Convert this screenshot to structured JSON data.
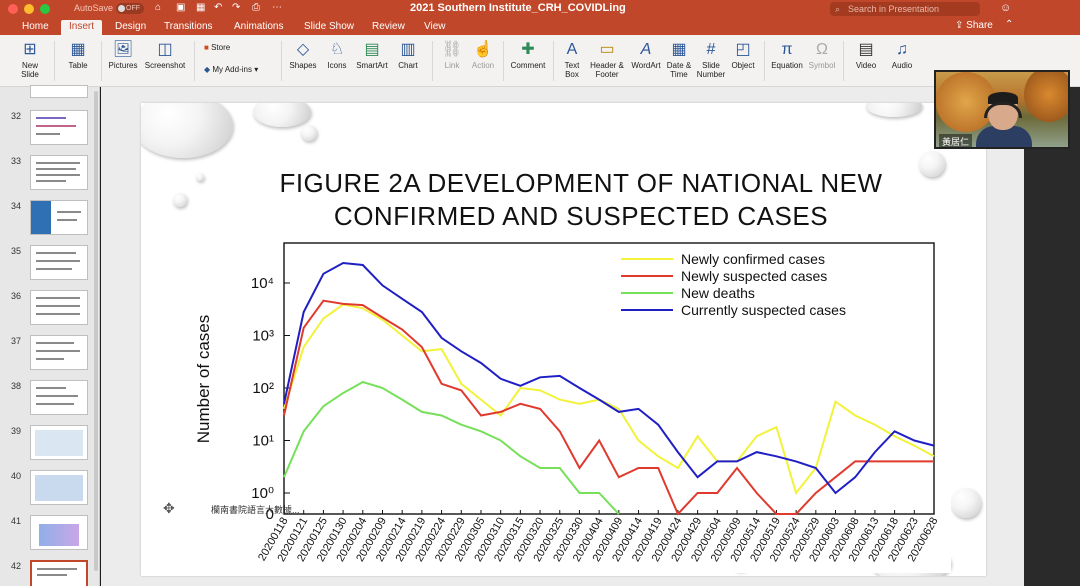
{
  "window": {
    "autosave_label": "AutoSave",
    "autosave_state": "OFF",
    "title": "2021 Southern Institute_CRH_COVIDLing",
    "search_placeholder": "Search in Presentation",
    "share_label": "Share"
  },
  "tabs": [
    "Home",
    "Insert",
    "Design",
    "Transitions",
    "Animations",
    "Slide Show",
    "Review",
    "View"
  ],
  "active_tab": "Insert",
  "ribbon": {
    "new_slide": "New Slide",
    "table": "Table",
    "pictures": "Pictures",
    "screenshot": "Screenshot",
    "store": "Store",
    "my_addins": "My Add-ins",
    "shapes": "Shapes",
    "icons": "Icons",
    "smartart": "SmartArt",
    "chart": "Chart",
    "link": "Link",
    "action": "Action",
    "comment": "Comment",
    "text_box": "Text Box",
    "header_footer": "Header & Footer",
    "wordart": "WordArt",
    "date_time": "Date & Time",
    "slide_number": "Slide Number",
    "object": "Object",
    "equation": "Equation",
    "symbol": "Symbol",
    "video": "Video",
    "audio": "Audio"
  },
  "slide_numbers": [
    "32",
    "33",
    "34",
    "35",
    "36",
    "37",
    "38",
    "39",
    "40",
    "41",
    "42"
  ],
  "selected_slide": "42",
  "slide": {
    "title_line1": "FIGURE 2A DEVELOPMENT OF NATIONAL NEW",
    "title_line2": "CONFIRMED AND SUSPECTED CASES",
    "credit": "欄南書院語言大數據..."
  },
  "participant": {
    "name": "黃居仁"
  },
  "colors": {
    "accent": "#c0472a",
    "confirmed": "#f2f23a",
    "suspected": "#e03a2e",
    "deaths": "#77e05a",
    "current": "#1f1fc4"
  },
  "chart_data": {
    "type": "line",
    "ylabel": "Number of cases",
    "y_scale": "log",
    "yticks": [
      "0",
      "10⁰",
      "10¹",
      "10²",
      "10³",
      "10⁴"
    ],
    "x": [
      "20200118",
      "20200121",
      "20200125",
      "20200130",
      "20200204",
      "20200209",
      "20200214",
      "20200219",
      "20200224",
      "20200229",
      "20200305",
      "20200310",
      "20200315",
      "20200320",
      "20200325",
      "20200330",
      "20200404",
      "20200409",
      "20200414",
      "20200419",
      "20200424",
      "20200429",
      "20200504",
      "20200509",
      "20200514",
      "20200519",
      "20200524",
      "20200529",
      "20200603",
      "20200608",
      "20200613",
      "20200618",
      "20200623",
      "20200628"
    ],
    "series": [
      {
        "name": "Newly confirmed cases",
        "values": [
          40,
          600,
          2100,
          3900,
          3300,
          2000,
          1000,
          500,
          550,
          120,
          60,
          30,
          100,
          90,
          60,
          50,
          60,
          40,
          10,
          5,
          3,
          12,
          4,
          4,
          12,
          18,
          1,
          3,
          55,
          30,
          20,
          12,
          8,
          5
        ]
      },
      {
        "name": "Newly suspected cases",
        "values": [
          30,
          1400,
          4600,
          4000,
          3800,
          2200,
          1300,
          600,
          120,
          90,
          30,
          35,
          50,
          40,
          15,
          3,
          10,
          2,
          3,
          3,
          0,
          1,
          1,
          3,
          1,
          0,
          0,
          1,
          2,
          4,
          4,
          4,
          4,
          4
        ]
      },
      {
        "name": "New deaths",
        "values": [
          2,
          15,
          45,
          80,
          130,
          100,
          60,
          35,
          30,
          20,
          15,
          10,
          5,
          3,
          3,
          1,
          1,
          0,
          0,
          0,
          0,
          0,
          0,
          0,
          0,
          0,
          0,
          0,
          0,
          0,
          0,
          0,
          0,
          0
        ]
      },
      {
        "name": "Currently suspected cases",
        "values": [
          50,
          2800,
          15000,
          24000,
          22000,
          9000,
          5000,
          2800,
          900,
          500,
          300,
          150,
          110,
          160,
          170,
          100,
          60,
          35,
          40,
          20,
          6,
          2,
          4,
          4,
          6,
          5,
          4,
          3,
          1,
          2,
          6,
          15,
          10,
          8
        ]
      }
    ]
  }
}
